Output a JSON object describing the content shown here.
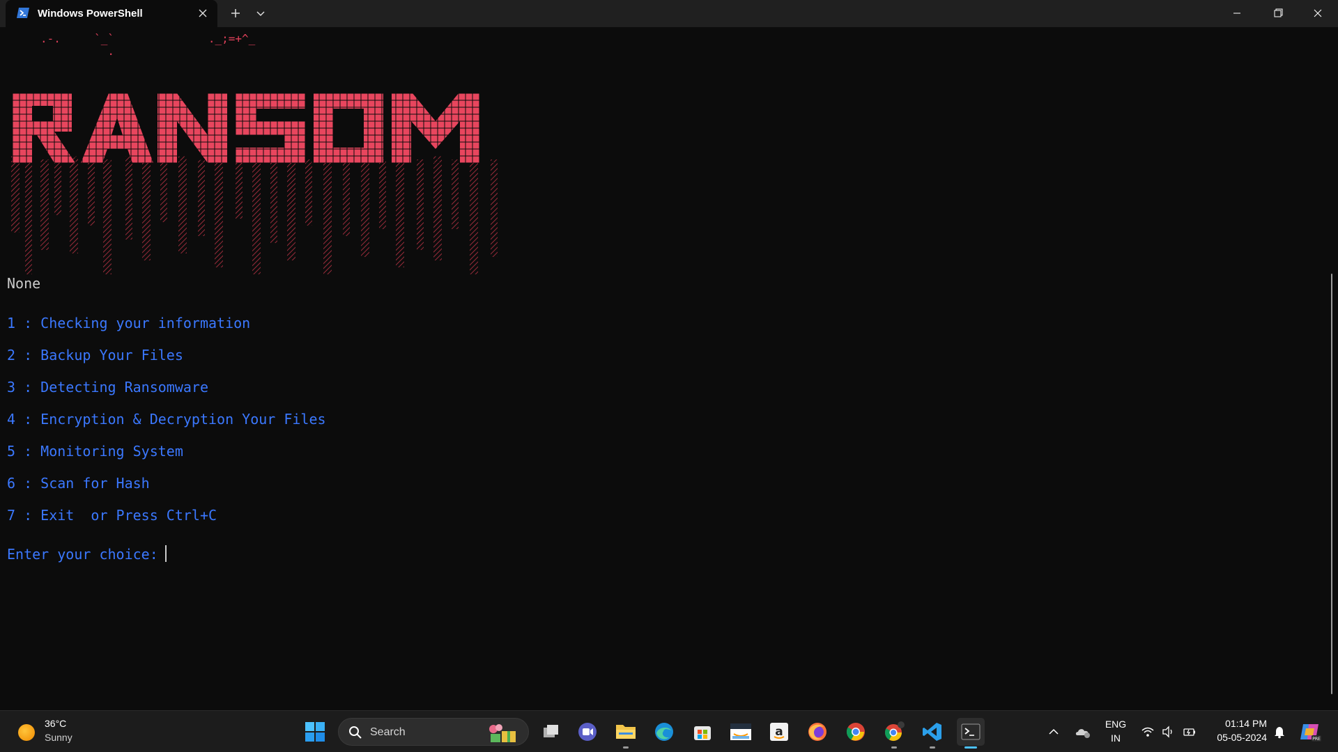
{
  "window": {
    "tab_title": "Windows PowerShell",
    "icons": [
      "powershell-icon",
      "close-icon",
      "plus-icon",
      "chevron-down-icon",
      "minimize-icon",
      "maximize-icon",
      "close-icon"
    ]
  },
  "terminal": {
    "art_top": ".-.     `_`              ._;=+^_\n          .",
    "banner_text": "RANSOM",
    "banner_color": "#e8465e",
    "none_text": "None",
    "menu": [
      "1 : Checking your information",
      "2 : Backup Your Files",
      "3 : Detecting Ransomware",
      "4 : Encryption & Decryption Your Files",
      "5 : Monitoring System",
      "6 : Scan for Hash",
      "7 : Exit  or Press Ctrl+C"
    ],
    "prompt": "Enter your choice: ",
    "text_color": "#3b78ff"
  },
  "taskbar": {
    "weather": {
      "temp": "36°C",
      "condition": "Sunny"
    },
    "search_placeholder": "Search",
    "apps": [
      "start-icon",
      "task-view-icon",
      "meet-icon",
      "file-explorer-icon",
      "edge-icon",
      "store-icon",
      "amazon-icon",
      "amazon-a-icon",
      "firefox-icon",
      "chrome-icon",
      "chrome-profile-icon",
      "vscode-icon",
      "terminal-icon"
    ],
    "tray": {
      "lang_top": "ENG",
      "lang_bottom": "IN",
      "time": "01:14 PM",
      "date": "05-05-2024"
    }
  }
}
